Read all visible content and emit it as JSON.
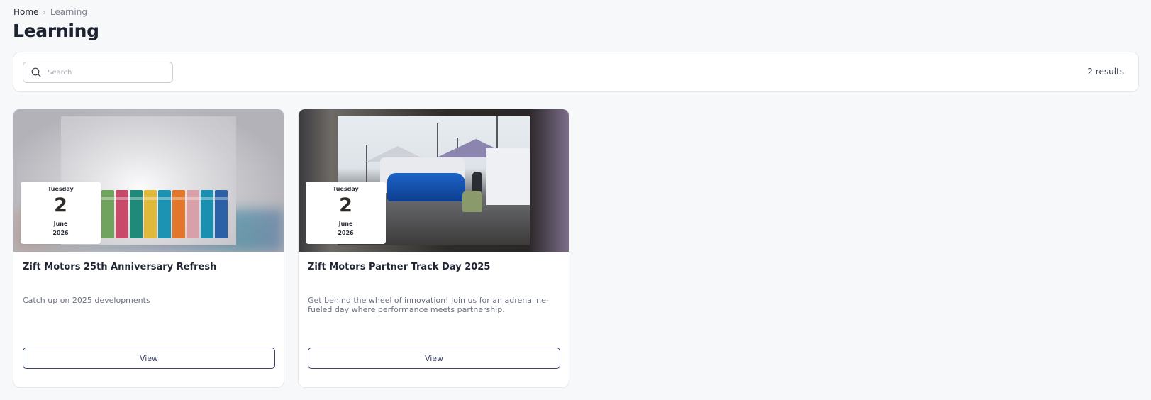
{
  "breadcrumb": {
    "home": "Home",
    "separator": "›",
    "current": "Learning"
  },
  "page": {
    "title": "Learning"
  },
  "search": {
    "placeholder": "Search",
    "value": ""
  },
  "results": {
    "text": "2 results"
  },
  "cards": [
    {
      "title": "Zift Motors 25th Anniversary Refresh",
      "description": "Catch up on 2025 developments",
      "date": {
        "weekday": "Tuesday",
        "day": "2",
        "month": "June",
        "year": "2026"
      },
      "button_label": "View"
    },
    {
      "title": "Zift Motors Partner Track Day 2025",
      "description": "Get behind the wheel of innovation! Join us for an adrenaline-fueled day where performance meets partnership.",
      "date": {
        "weekday": "Tuesday",
        "day": "2",
        "month": "June",
        "year": "2026"
      },
      "button_label": "View"
    }
  ],
  "colors": {
    "accent": "#3b4366",
    "background": "#f7f8fa"
  }
}
